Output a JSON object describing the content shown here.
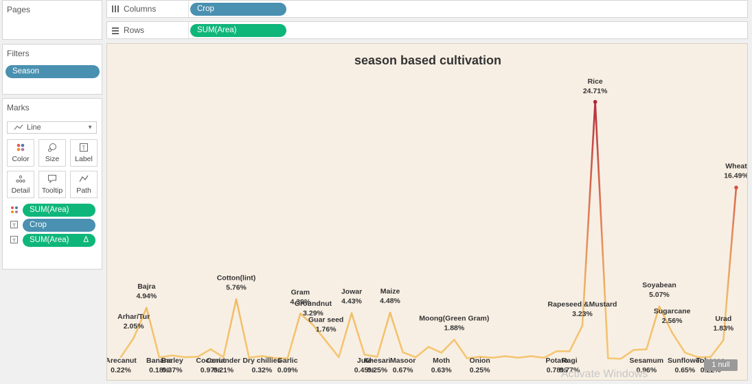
{
  "sidebar": {
    "pages_title": "Pages",
    "filters_title": "Filters",
    "filter_pill": "Season",
    "marks_title": "Marks",
    "mark_type": "Line",
    "buttons": [
      {
        "label": "Color",
        "icon": "color-dots-icon"
      },
      {
        "label": "Size",
        "icon": "size-icon"
      },
      {
        "label": "Label",
        "icon": "label-icon"
      },
      {
        "label": "Detail",
        "icon": "detail-icon"
      },
      {
        "label": "Tooltip",
        "icon": "tooltip-icon"
      },
      {
        "label": "Path",
        "icon": "path-icon"
      }
    ],
    "mark_fields": [
      {
        "label": "SUM(Area)",
        "icon": "color-dots-icon",
        "color": "#0fb67a"
      },
      {
        "label": "Crop",
        "icon": "label-icon",
        "color": "#4a90b0"
      },
      {
        "label": "SUM(Area)",
        "delta": "Δ",
        "icon": "label-icon",
        "color": "#0fb67a"
      }
    ]
  },
  "shelves": {
    "columns_label": "Columns",
    "columns_pill": "Crop",
    "rows_label": "Rows",
    "rows_pill": "SUM(Area)"
  },
  "null_indicator": "1 null",
  "watermark": "Activate Windows",
  "colors": {
    "dimension": "#4a90b0",
    "measure": "#0fb67a",
    "chart_bg": "#f8efe4",
    "line_low": "#f2c46b",
    "line_high": "#b2283a"
  },
  "chart_data": {
    "type": "line",
    "title": "season based cultivation",
    "xlabel": "",
    "ylabel": "",
    "ylim": [
      0,
      26
    ],
    "grid": false,
    "points": [
      {
        "crop": "Arecanut",
        "value": 0.22,
        "label": "Arecanut",
        "pct": "0.22%"
      },
      {
        "crop": "Arhar/Tur",
        "value": 2.05,
        "label": "Arhar/Tur",
        "pct": "2.05%"
      },
      {
        "crop": "Bajra",
        "value": 4.94,
        "label": "Bajra",
        "pct": "4.94%"
      },
      {
        "crop": "Banana",
        "value": 0.18,
        "label": "Banana",
        "pct": "0.18%"
      },
      {
        "crop": "Barley",
        "value": 0.37,
        "label": "Barley",
        "pct": "0.37%"
      },
      {
        "crop": "",
        "value": 0.2,
        "label": "",
        "pct": ""
      },
      {
        "crop": "",
        "value": 0.25,
        "label": "",
        "pct": ""
      },
      {
        "crop": "Coconut",
        "value": 0.97,
        "label": "Coconut",
        "pct": "0.97%"
      },
      {
        "crop": "Coriander",
        "value": 0.21,
        "label": "Coriander",
        "pct": "0.21%"
      },
      {
        "crop": "Cotton(lint)",
        "value": 5.76,
        "label": "Cotton(lint)",
        "pct": "5.76%"
      },
      {
        "crop": "",
        "value": 0.15,
        "label": "",
        "pct": ""
      },
      {
        "crop": "Dry chillies",
        "value": 0.32,
        "label": "Dry chillies",
        "pct": "0.32%"
      },
      {
        "crop": "",
        "value": 0.12,
        "label": "",
        "pct": ""
      },
      {
        "crop": "Garlic",
        "value": 0.09,
        "label": "Garlic",
        "pct": "0.09%"
      },
      {
        "crop": "Gram",
        "value": 4.39,
        "label": "Gram",
        "pct": "4.39%"
      },
      {
        "crop": "Groundnut",
        "value": 3.29,
        "label": "Groundnut",
        "pct": "3.29%"
      },
      {
        "crop": "Guar seed",
        "value": 1.76,
        "label": "Guar seed",
        "pct": "1.76%"
      },
      {
        "crop": "",
        "value": 0.2,
        "label": "",
        "pct": ""
      },
      {
        "crop": "Jowar",
        "value": 4.43,
        "label": "Jowar",
        "pct": "4.43%"
      },
      {
        "crop": "Jute",
        "value": 0.45,
        "label": "Jute",
        "pct": "0.45%"
      },
      {
        "crop": "Khesari",
        "value": 0.25,
        "label": "Khesari",
        "pct": "0.25%"
      },
      {
        "crop": "Maize",
        "value": 4.48,
        "label": "Maize",
        "pct": "4.48%"
      },
      {
        "crop": "Masoor",
        "value": 0.67,
        "label": "Masoor",
        "pct": "0.67%"
      },
      {
        "crop": "",
        "value": 0.2,
        "label": "",
        "pct": ""
      },
      {
        "crop": "",
        "value": 1.2,
        "label": "",
        "pct": ""
      },
      {
        "crop": "Moth",
        "value": 0.63,
        "label": "Moth",
        "pct": "0.63%"
      },
      {
        "crop": "Moong(Green Gram)",
        "value": 1.88,
        "label": "Moong(Green Gram)",
        "pct": "1.88%"
      },
      {
        "crop": "",
        "value": 0.1,
        "label": "",
        "pct": ""
      },
      {
        "crop": "Onion",
        "value": 0.25,
        "label": "Onion",
        "pct": "0.25%"
      },
      {
        "crop": "",
        "value": 0.15,
        "label": "",
        "pct": ""
      },
      {
        "crop": "",
        "value": 0.3,
        "label": "",
        "pct": ""
      },
      {
        "crop": "",
        "value": 0.15,
        "label": "",
        "pct": ""
      },
      {
        "crop": "",
        "value": 0.3,
        "label": "",
        "pct": ""
      },
      {
        "crop": "",
        "value": 0.15,
        "label": "",
        "pct": ""
      },
      {
        "crop": "Potato",
        "value": 0.78,
        "label": "Potato",
        "pct": "0.78%"
      },
      {
        "crop": "Ragi",
        "value": 0.77,
        "label": "Ragi",
        "pct": "0.77%"
      },
      {
        "crop": "Rapeseed &Mustard",
        "value": 3.23,
        "label": "Rapeseed &Mustard",
        "pct": "3.23%"
      },
      {
        "crop": "Rice",
        "value": 24.71,
        "label": "Rice",
        "pct": "24.71%"
      },
      {
        "crop": "",
        "value": 0.1,
        "label": "",
        "pct": ""
      },
      {
        "crop": "",
        "value": 0.05,
        "label": "",
        "pct": ""
      },
      {
        "crop": "",
        "value": 0.9,
        "label": "",
        "pct": ""
      },
      {
        "crop": "Sesamum",
        "value": 0.96,
        "label": "Sesamum",
        "pct": "0.96%"
      },
      {
        "crop": "Soyabean",
        "value": 5.07,
        "label": "Soyabean",
        "pct": "5.07%"
      },
      {
        "crop": "Sugarcane",
        "value": 2.56,
        "label": "Sugarcane",
        "pct": "2.56%"
      },
      {
        "crop": "Sunflower",
        "value": 0.65,
        "label": "Sunflower",
        "pct": "0.65%"
      },
      {
        "crop": "",
        "value": 0.2,
        "label": "",
        "pct": ""
      },
      {
        "crop": "Tobacco",
        "value": 0.22,
        "label": "Tobacco",
        "pct": "0.22%"
      },
      {
        "crop": "Urad",
        "value": 1.83,
        "label": "Urad",
        "pct": "1.83%"
      },
      {
        "crop": "Wheat",
        "value": 16.49,
        "label": "Wheat",
        "pct": "16.49%"
      }
    ]
  }
}
